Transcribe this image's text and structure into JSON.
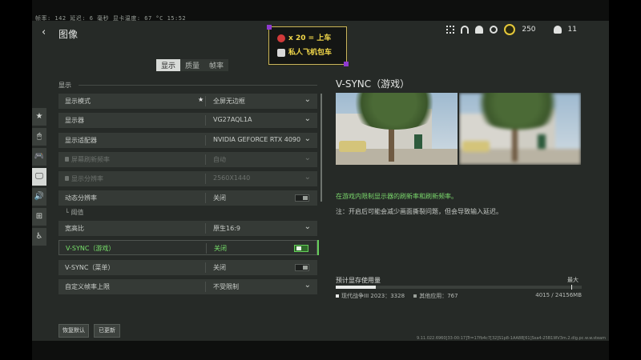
{
  "stats": {
    "text": "帧率: 142   延迟: 6 毫秒   显卡温度: 67 °C    15:52"
  },
  "header": {
    "back_glyph": "‹",
    "title": "图像"
  },
  "promo": {
    "line1": "x 20 = 上车",
    "line2": "私人飞机包车"
  },
  "hud": {
    "coins": "250",
    "friends": "11"
  },
  "tabs": [
    "显示",
    "质量",
    "帧率"
  ],
  "section": {
    "label": "显示"
  },
  "sidebar": {
    "items": [
      "★",
      "🖱",
      "🎮",
      "🖵",
      "🔊",
      "⊞",
      "♿"
    ],
    "active_index": 3
  },
  "settings": {
    "display_mode": {
      "label": "显示模式",
      "value": "全屏无边框"
    },
    "monitor": {
      "label": "显示器",
      "value": "VG27AQL1A"
    },
    "adapter": {
      "label": "显示适配器",
      "value": "NVIDIA GEFORCE RTX 4090"
    },
    "refresh": {
      "label": "屏幕刷新频率",
      "value": "自动"
    },
    "resolution": {
      "label": "显示分辨率",
      "value": "2560X1440"
    },
    "dynamic_res": {
      "label": "动态分辨率",
      "value": "关闭"
    },
    "dynamic_res_sub": {
      "label": "└ 阈值"
    },
    "aspect": {
      "label": "宽高比",
      "value": "原生16:9"
    },
    "vsync_game": {
      "label": "V-SYNC（游戏）",
      "value": "关闭"
    },
    "vsync_menu": {
      "label": "V-SYNC（菜单）",
      "value": "关闭"
    },
    "custom_frame": {
      "label": "自定义帧率上限",
      "value": "不受限制"
    }
  },
  "preview": {
    "title": "V-SYNC（游戏）",
    "hint_green": "在游戏内限制显示器的刷新率和刷新频率。",
    "hint_note": "注：开启后可能会减少画面撕裂问题，但会导致输入延迟。"
  },
  "vram": {
    "title": "预计显存使用量",
    "max_label": "最大",
    "used_fraction": 0.164,
    "legend_game": "现代战争III 2023：3328",
    "legend_other": "其他应用：767",
    "total": "4015 / 24156MB",
    "colors": {
      "game": "#e8eae8",
      "other": "#9aa09a"
    }
  },
  "buttons": {
    "reset": "恢复默认",
    "restart": "已更新"
  },
  "build": {
    "text": "9.11.022.6960[33-00:17]Tr=17fb4c7[32]S1p8-1AA88[61]Ssa4-25B1WV3m.2.dlg.pc.w.w.steam"
  }
}
